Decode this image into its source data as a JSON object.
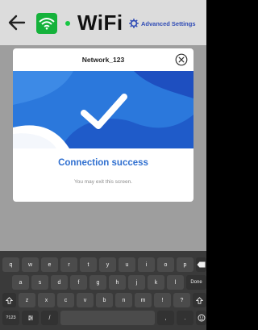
{
  "header": {
    "title": "WiFi",
    "advanced_settings_label": "Advanced Settings",
    "status_color": "#18c744",
    "wifi_tile_color": "#15b23b",
    "icons": {
      "back": "back-arrow-icon",
      "wifi": "wifi-icon",
      "settings": "gear-icon"
    }
  },
  "dialog": {
    "network_name": "Network_123",
    "close_icon": "close-circle-icon",
    "success_icon": "checkmark-icon",
    "success_title": "Connection success",
    "success_message": "You may exit this screen.",
    "accent_color": "#2f6fd0"
  },
  "keyboard": {
    "row1": [
      "q",
      "w",
      "e",
      "r",
      "t",
      "y",
      "u",
      "i",
      "o",
      "p"
    ],
    "row2": [
      "a",
      "s",
      "d",
      "f",
      "g",
      "h",
      "j",
      "k",
      "l"
    ],
    "row3": [
      "z",
      "x",
      "c",
      "v",
      "b",
      "n",
      "m",
      "!",
      "?"
    ],
    "done_label": "Done",
    "numbers_label": "?123",
    "comma_label": ",",
    "period_label": ".",
    "slash_label": "/",
    "icons": {
      "backspace": "backspace-icon",
      "shift": "shift-icon",
      "emoji": "emoji-icon",
      "settings": "keyboard-settings-icon"
    }
  }
}
